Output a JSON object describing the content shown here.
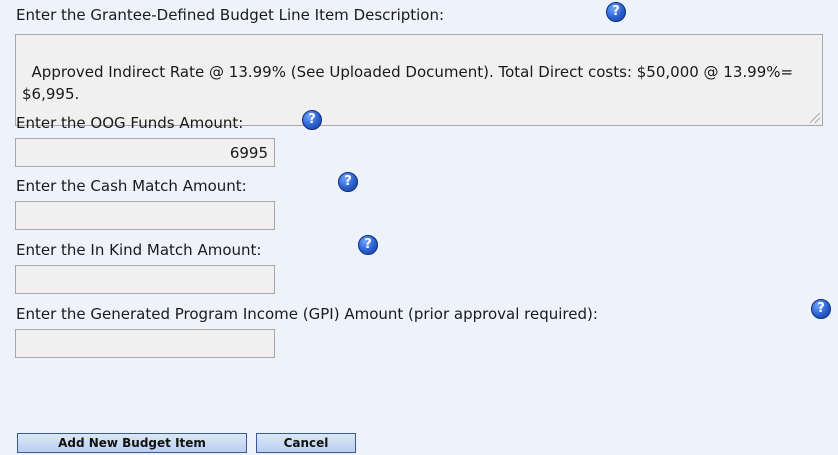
{
  "description": {
    "label": "Enter the Grantee-Defined Budget Line Item Description:",
    "value": "Approved Indirect Rate @ 13.99% (See Uploaded Document). Total Direct costs: $50,000 @ 13.99%= $6,995."
  },
  "oog_funds": {
    "label": "Enter the OOG Funds Amount:",
    "value": "6995"
  },
  "cash_match": {
    "label": "Enter the Cash Match Amount:",
    "value": ""
  },
  "in_kind_match": {
    "label": "Enter the In Kind Match Amount:",
    "value": ""
  },
  "gpi": {
    "label": "Enter the Generated Program Income (GPI) Amount (prior approval required):",
    "value": ""
  },
  "help_icon_glyph": "?",
  "buttons": {
    "add_label": "Add New Budget Item",
    "cancel_label": "Cancel"
  }
}
